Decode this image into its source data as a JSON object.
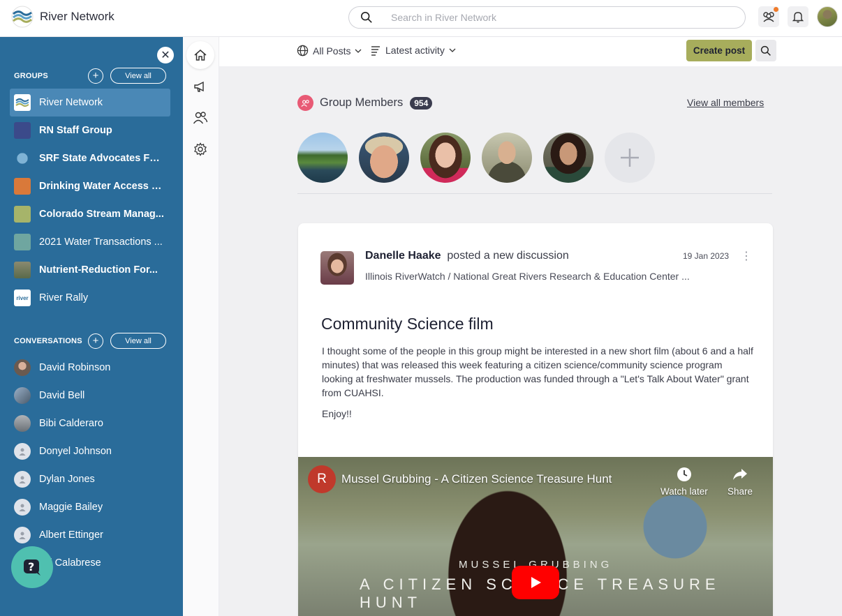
{
  "header": {
    "brand": "River Network",
    "search_placeholder": "Search in River Network"
  },
  "sidebar": {
    "groups_title": "GROUPS",
    "view_all": "View all",
    "groups": [
      {
        "label": "River Network",
        "active": true
      },
      {
        "label": "RN Staff Group",
        "bold": true
      },
      {
        "label": "SRF State Advocates For...",
        "bold": true
      },
      {
        "label": "Drinking Water Access E...",
        "bold": true
      },
      {
        "label": "Colorado Stream Manag...",
        "bold": true
      },
      {
        "label": "2021 Water Transactions ...",
        "bold": false
      },
      {
        "label": "Nutrient-Reduction For...",
        "bold": true
      },
      {
        "label": "River Rally",
        "bold": false
      }
    ],
    "conversations_title": "CONVERSATIONS",
    "conversations": [
      {
        "name": "David Robinson"
      },
      {
        "name": "David Bell"
      },
      {
        "name": "Bibi Calderaro"
      },
      {
        "name": "Donyel Johnson"
      },
      {
        "name": "Dylan Jones"
      },
      {
        "name": "Maggie Bailey"
      },
      {
        "name": "Albert Ettinger"
      },
      {
        "name": "Jul Calabrese"
      }
    ]
  },
  "filters": {
    "all_posts": "All Posts",
    "latest_activity": "Latest activity",
    "create_post": "Create post"
  },
  "members": {
    "title": "Group Members",
    "count": "954",
    "view_all": "View all members"
  },
  "post": {
    "author": "Danelle Haake",
    "action": "posted a new discussion",
    "group": "Illinois RiverWatch / National Great Rivers Research & Education Center ...",
    "date": "19 Jan 2023",
    "title": "Community Science film",
    "body": "I thought some of the people in this group might be interested in a new short film (about 6 and a half minutes) that was released this week featuring a citizen science/community science program looking at freshwater mussels.  The production was funded through a \"Let's Talk About Water\" grant from CUAHSI.",
    "signoff": "Enjoy!!"
  },
  "video": {
    "channel_initial": "R",
    "title": "Mussel Grubbing - A Citizen Science Treasure Hunt",
    "watch_later": "Watch later",
    "share": "Share",
    "overlay_line1": "MUSSEL GRUBBING",
    "overlay_line2": "A CITIZEN SCIENCE TREASURE HUNT"
  },
  "colors": {
    "sidebar": "#2a6c9a",
    "accent_button": "#a7ad5c",
    "members_icon": "#e85a75",
    "notification_dot": "#f07b2a"
  }
}
